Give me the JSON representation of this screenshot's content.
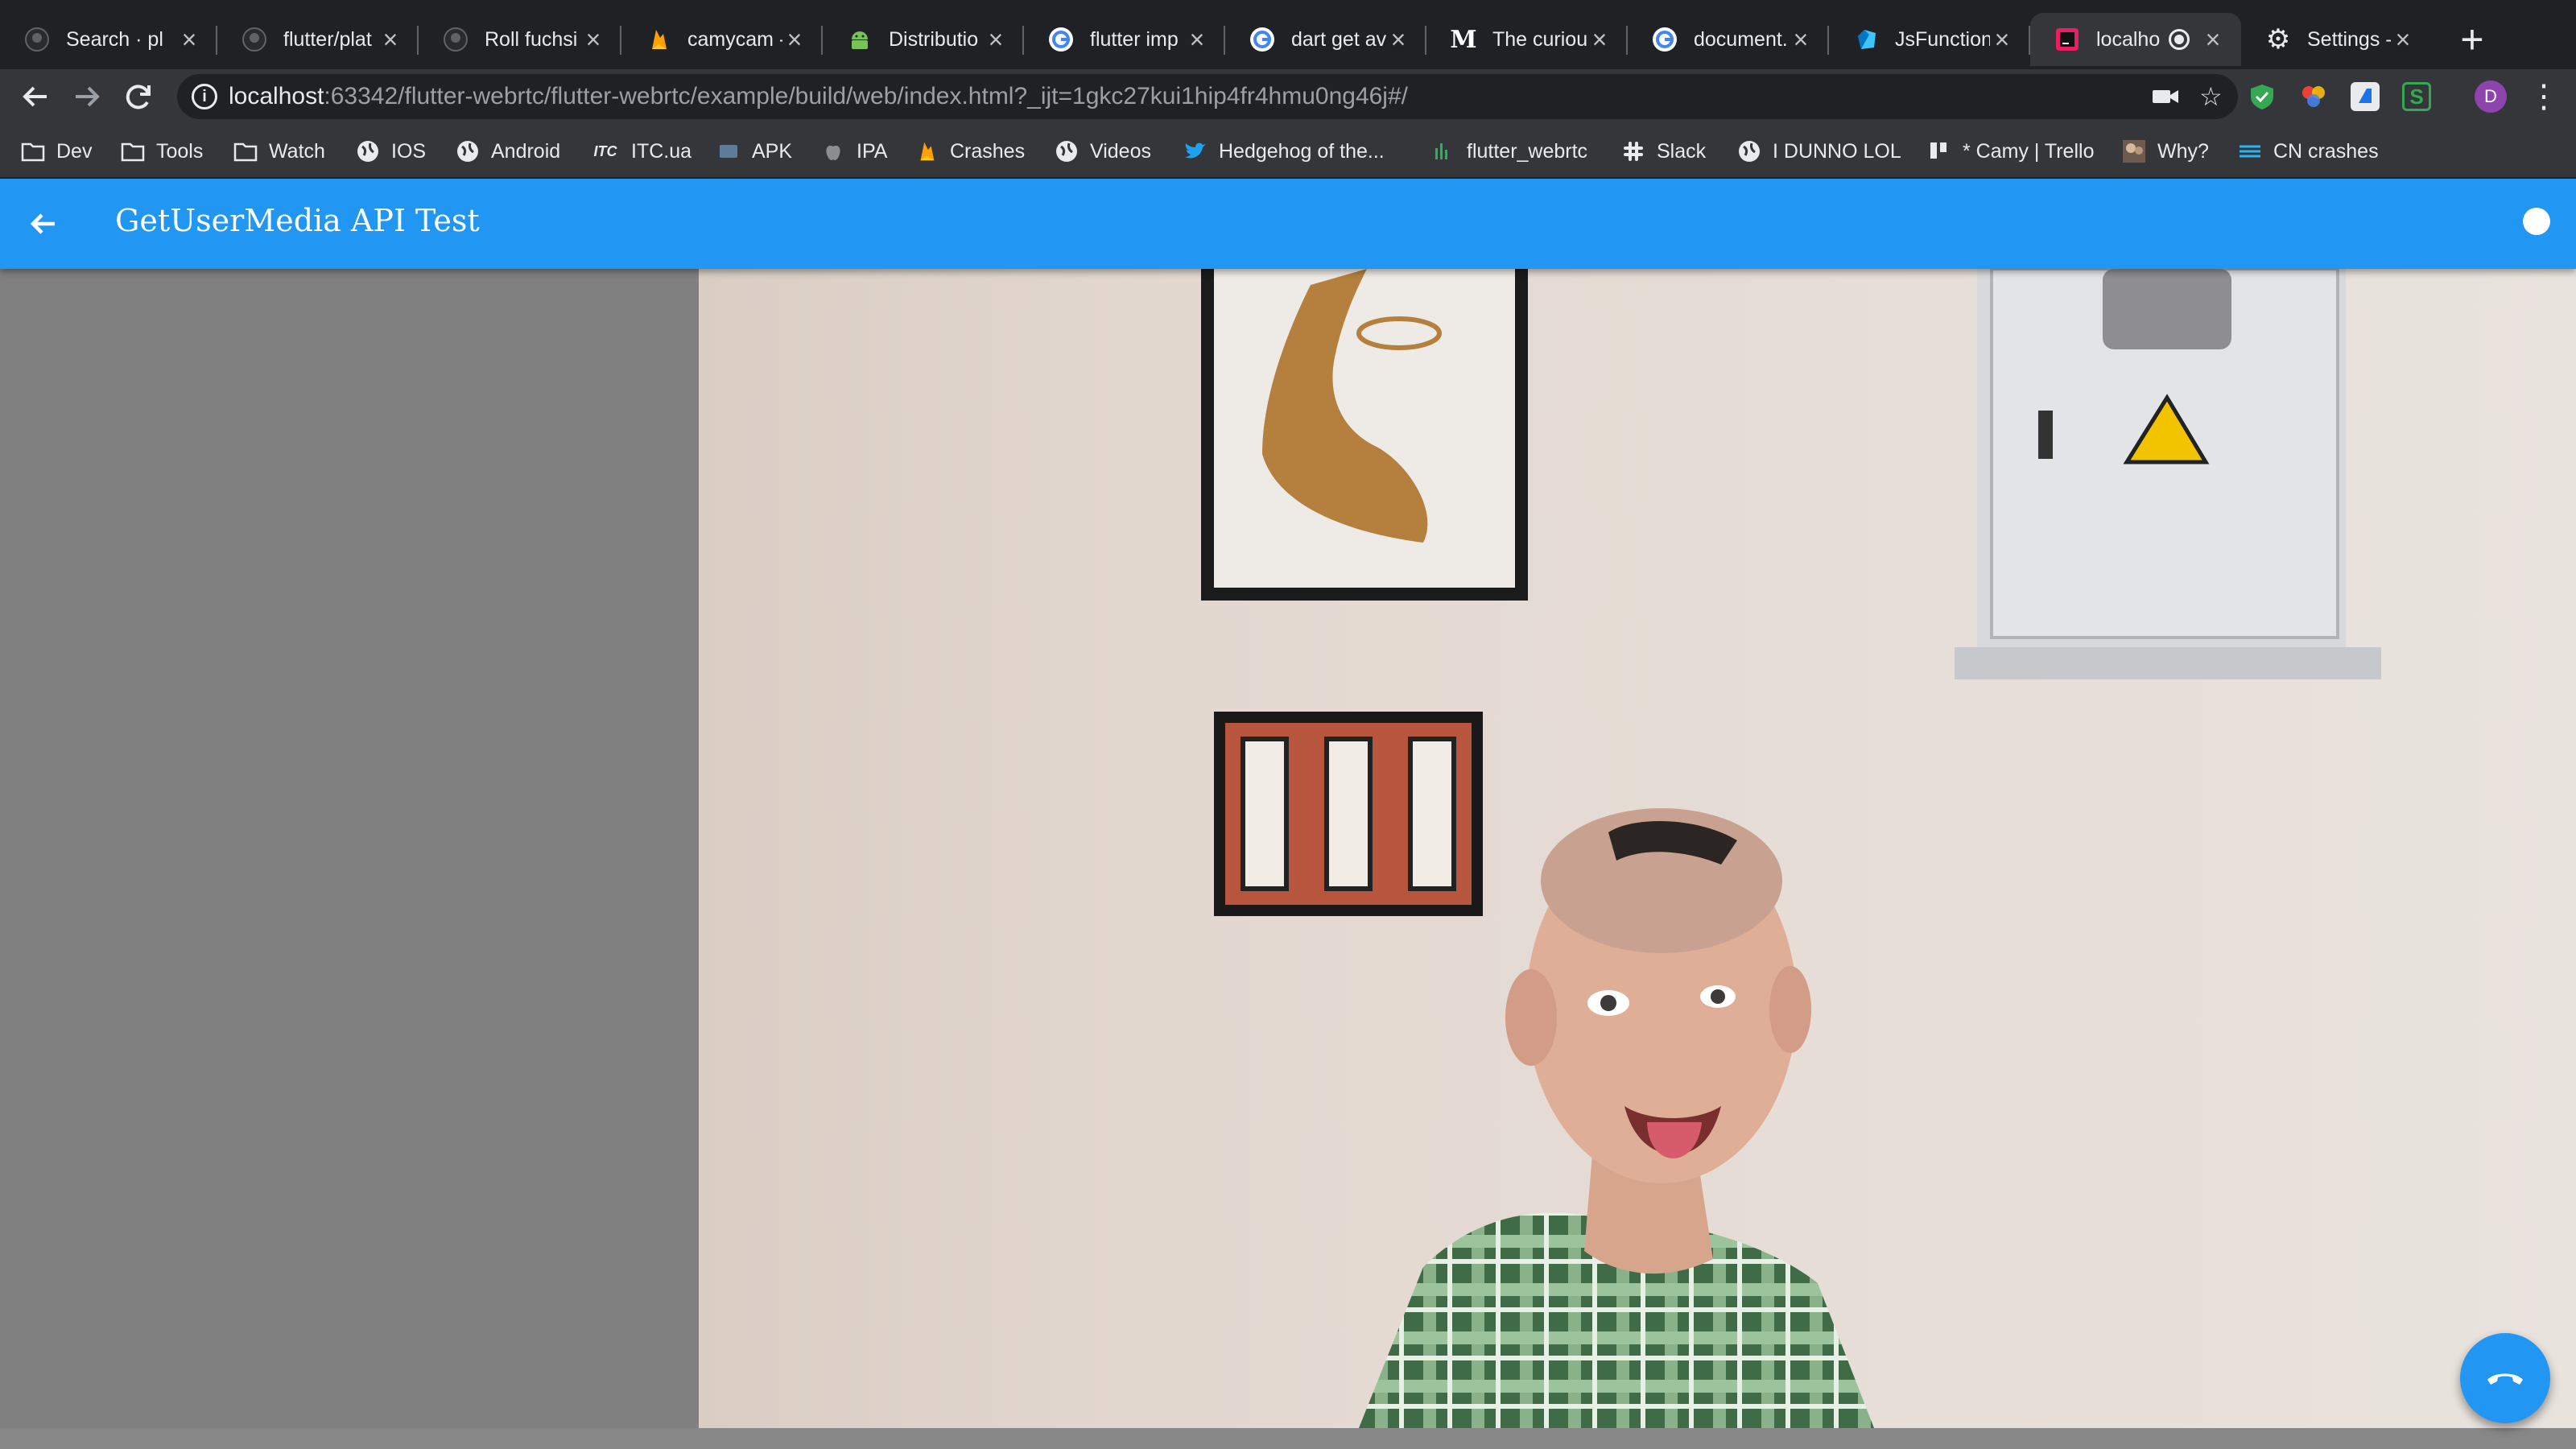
{
  "browser": {
    "tabs": [
      {
        "title": "Search · pl",
        "favicon": "github-icon",
        "color": "#5f6368"
      },
      {
        "title": "flutter/plat",
        "favicon": "github-icon",
        "color": "#5f6368"
      },
      {
        "title": "Roll fuchsi",
        "favicon": "github-icon",
        "color": "#5f6368"
      },
      {
        "title": "camycam -",
        "favicon": "firebase-icon",
        "color": "#ffa000"
      },
      {
        "title": "Distributio",
        "favicon": "android-icon",
        "color": "#78c257"
      },
      {
        "title": "flutter imp",
        "favicon": "google-icon",
        "color": "#ffffff"
      },
      {
        "title": "dart get av",
        "favicon": "google-icon",
        "color": "#ffffff"
      },
      {
        "title": "The curiou",
        "favicon": "medium-icon",
        "color": "#ffffff"
      },
      {
        "title": "document.",
        "favicon": "google-icon",
        "color": "#ffffff"
      },
      {
        "title": "JsFunction",
        "favicon": "dart-icon",
        "color": "#40c4ff"
      },
      {
        "title": "localho",
        "favicon": "intellij-icon",
        "color": "#e91e63",
        "active": true
      },
      {
        "title": "Settings -",
        "favicon": "gear-icon",
        "color": "#ffffff"
      }
    ],
    "url_host": "localhost",
    "url_rest": ":63342/flutter-webrtc/flutter-webrtc/example/build/web/index.html?_ijt=1gkc27kui1hip4fr4hmu0ng46j#/",
    "profile_initial": "D",
    "bookmarks": [
      {
        "label": "Dev",
        "icon": "folder-icon"
      },
      {
        "label": "Tools",
        "icon": "folder-icon"
      },
      {
        "label": "Watch",
        "icon": "folder-icon"
      },
      {
        "label": "IOS",
        "icon": "globe-icon"
      },
      {
        "label": "Android",
        "icon": "globe-icon"
      },
      {
        "label": "ITC.ua",
        "icon": "itc-icon"
      },
      {
        "label": "APK",
        "icon": "apk-icon"
      },
      {
        "label": "IPA",
        "icon": "apple-icon"
      },
      {
        "label": "Crashes",
        "icon": "firebase-icon"
      },
      {
        "label": "Videos",
        "icon": "globe-icon"
      },
      {
        "label": "Hedgehog of the...",
        "icon": "twitter-icon"
      },
      {
        "label": "flutter_webrtc",
        "icon": "activity-icon"
      },
      {
        "label": "Slack",
        "icon": "slack-icon"
      },
      {
        "label": "I DUNNO LOL",
        "icon": "globe-icon"
      },
      {
        "label": "* Camy | Trello",
        "icon": "trello-icon"
      },
      {
        "label": "Why?",
        "icon": "photo-icon"
      },
      {
        "label": "CN crashes",
        "icon": "stack-icon"
      }
    ]
  },
  "app": {
    "title": "GetUserMedia API Test",
    "accent": "#2196f3",
    "fab_icon": "call-end-icon"
  }
}
